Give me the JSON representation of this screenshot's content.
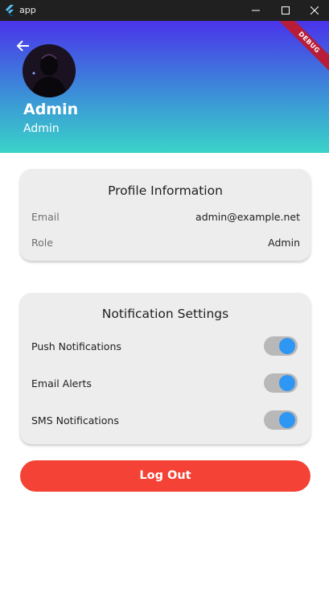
{
  "window": {
    "title": "app",
    "app_icon": "flutter-icon",
    "controls": [
      "minimize-icon",
      "maximize-icon",
      "close-icon"
    ]
  },
  "header": {
    "back_icon": "arrow-left-icon",
    "name": "Admin",
    "role": "Admin",
    "debug_banner": "DEBUG",
    "gradient_colors": [
      "#4a33ea",
      "#3ad3c8"
    ]
  },
  "profile_info": {
    "title": "Profile Information",
    "rows": [
      {
        "label": "Email",
        "value": "admin@example.net"
      },
      {
        "label": "Role",
        "value": "Admin"
      }
    ]
  },
  "notification_settings": {
    "title": "Notification Settings",
    "items": [
      {
        "label": "Push Notifications",
        "enabled": true
      },
      {
        "label": "Email Alerts",
        "enabled": true
      },
      {
        "label": "SMS Notifications",
        "enabled": true
      }
    ]
  },
  "logout": {
    "label": "Log Out",
    "color": "#f44336"
  },
  "colors": {
    "toggle_on": "#2e96f3",
    "toggle_track": "#b8b8b8",
    "card_bg": "#ededed"
  }
}
